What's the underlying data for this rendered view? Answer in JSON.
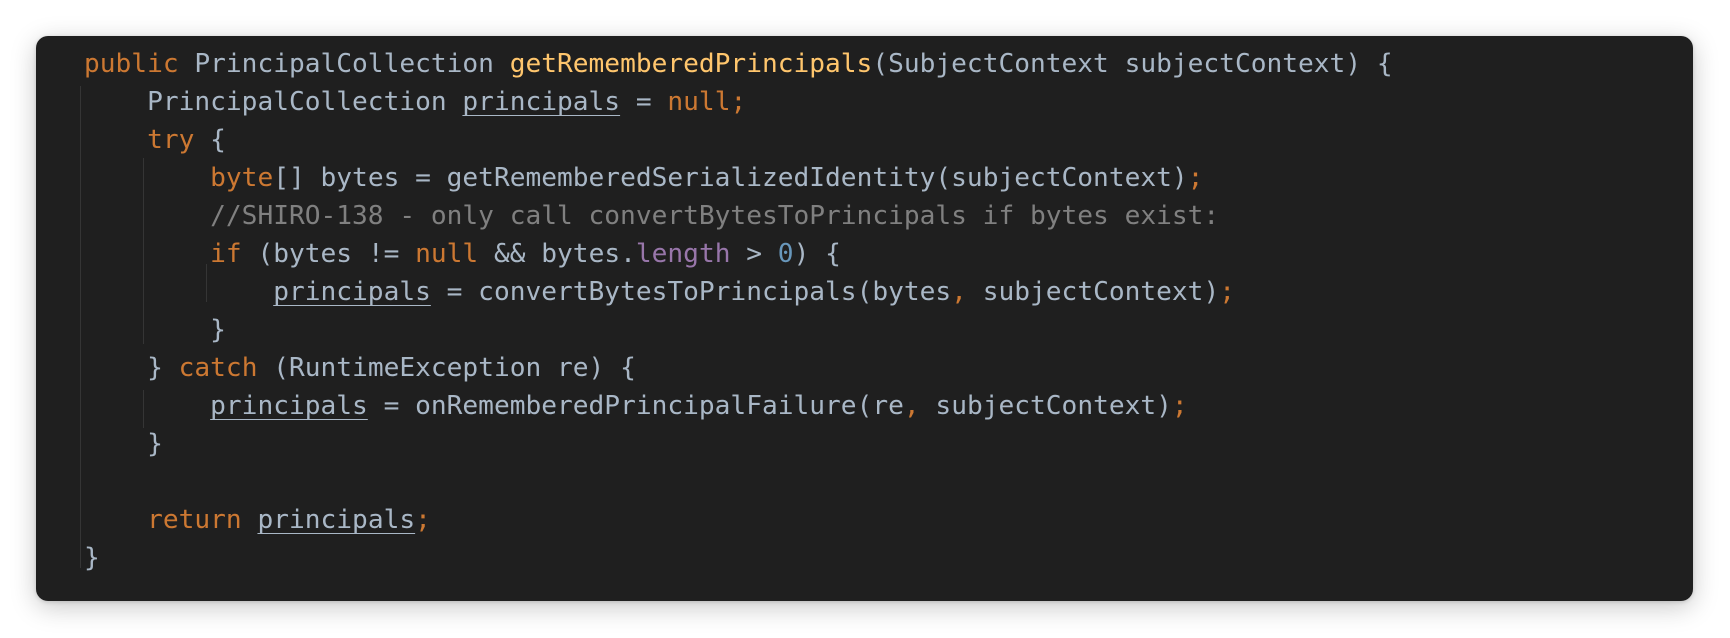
{
  "code_lines": [
    {
      "indent": 0,
      "tokens": [
        {
          "text": "public ",
          "type": "keyword"
        },
        {
          "text": "PrincipalCollection ",
          "type": "plain"
        },
        {
          "text": "getRememberedPrincipals",
          "type": "method"
        },
        {
          "text": "(SubjectContext subjectContext) {",
          "type": "plain"
        }
      ]
    },
    {
      "indent": 1,
      "tokens": [
        {
          "text": "PrincipalCollection ",
          "type": "plain"
        },
        {
          "text": "principals",
          "type": "var"
        },
        {
          "text": " = ",
          "type": "plain"
        },
        {
          "text": "null",
          "type": "keyword"
        },
        {
          "text": ";",
          "type": "punct"
        }
      ]
    },
    {
      "indent": 1,
      "tokens": [
        {
          "text": "try ",
          "type": "keyword"
        },
        {
          "text": "{",
          "type": "plain"
        }
      ]
    },
    {
      "indent": 2,
      "tokens": [
        {
          "text": "byte",
          "type": "keyword"
        },
        {
          "text": "[] bytes = getRememberedSerializedIdentity(subjectContext)",
          "type": "plain"
        },
        {
          "text": ";",
          "type": "punct"
        }
      ]
    },
    {
      "indent": 2,
      "tokens": [
        {
          "text": "//SHIRO-138 - only call convertBytesToPrincipals if bytes exist:",
          "type": "comment"
        }
      ]
    },
    {
      "indent": 2,
      "tokens": [
        {
          "text": "if ",
          "type": "keyword"
        },
        {
          "text": "(bytes != ",
          "type": "plain"
        },
        {
          "text": "null ",
          "type": "keyword"
        },
        {
          "text": "&& bytes.",
          "type": "plain"
        },
        {
          "text": "length",
          "type": "field"
        },
        {
          "text": " > ",
          "type": "plain"
        },
        {
          "text": "0",
          "type": "number"
        },
        {
          "text": ") {",
          "type": "plain"
        }
      ]
    },
    {
      "indent": 3,
      "tokens": [
        {
          "text": "principals",
          "type": "var"
        },
        {
          "text": " = convertBytesToPrincipals(bytes",
          "type": "plain"
        },
        {
          "text": ", ",
          "type": "punct"
        },
        {
          "text": "subjectContext)",
          "type": "plain"
        },
        {
          "text": ";",
          "type": "punct"
        }
      ]
    },
    {
      "indent": 2,
      "tokens": [
        {
          "text": "}",
          "type": "plain"
        }
      ]
    },
    {
      "indent": 1,
      "tokens": [
        {
          "text": "} ",
          "type": "plain"
        },
        {
          "text": "catch ",
          "type": "keyword"
        },
        {
          "text": "(RuntimeException re) {",
          "type": "plain"
        }
      ]
    },
    {
      "indent": 2,
      "tokens": [
        {
          "text": "principals",
          "type": "var"
        },
        {
          "text": " = onRememberedPrincipalFailure(re",
          "type": "plain"
        },
        {
          "text": ", ",
          "type": "punct"
        },
        {
          "text": "subjectContext)",
          "type": "plain"
        },
        {
          "text": ";",
          "type": "punct"
        }
      ]
    },
    {
      "indent": 1,
      "tokens": [
        {
          "text": "}",
          "type": "plain"
        }
      ]
    },
    {
      "indent": 0,
      "tokens": []
    },
    {
      "indent": 1,
      "tokens": [
        {
          "text": "return ",
          "type": "keyword"
        },
        {
          "text": "principals",
          "type": "var"
        },
        {
          "text": ";",
          "type": "punct"
        }
      ]
    },
    {
      "indent": 0,
      "tokens": [
        {
          "text": "}",
          "type": "plain"
        }
      ]
    }
  ]
}
